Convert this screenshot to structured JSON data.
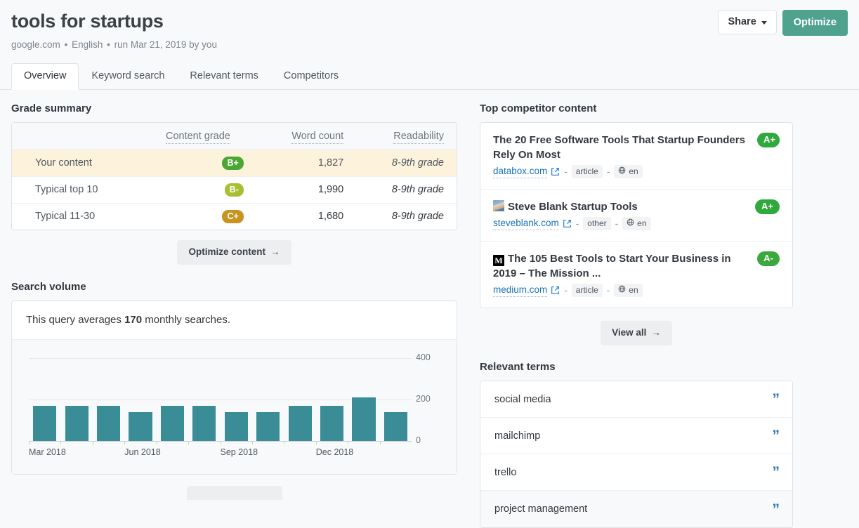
{
  "header": {
    "title": "tools for startups",
    "meta": {
      "domain": "google.com",
      "language": "English",
      "run": "run Mar 21, 2019 by you"
    },
    "share_label": "Share",
    "optimize_label": "Optimize"
  },
  "tabs": [
    {
      "label": "Overview",
      "active": true
    },
    {
      "label": "Keyword search",
      "active": false
    },
    {
      "label": "Relevant terms",
      "active": false
    },
    {
      "label": "Competitors",
      "active": false
    }
  ],
  "grade_summary": {
    "title": "Grade summary",
    "columns": [
      "",
      "Content grade",
      "Word count",
      "Readability"
    ],
    "rows": [
      {
        "label": "Your content",
        "grade": "B+",
        "grade_color": "#4aa832",
        "word_count": "1,827",
        "readability": "8-9th grade",
        "highlight": true
      },
      {
        "label": "Typical top 10",
        "grade": "B-",
        "grade_color": "#a7bf32",
        "word_count": "1,990",
        "readability": "8-9th grade",
        "highlight": false
      },
      {
        "label": "Typical 11-30",
        "grade": "C+",
        "grade_color": "#c99322",
        "word_count": "1,680",
        "readability": "8-9th grade",
        "highlight": false
      }
    ],
    "optimize_content_label": "Optimize content",
    "arrow": "→"
  },
  "search_volume": {
    "title": "Search volume",
    "summary_prefix": "This query averages",
    "summary_value": "170",
    "summary_suffix": "monthly searches."
  },
  "chart_data": {
    "type": "bar",
    "title": "Search volume",
    "xlabel": "",
    "ylabel": "",
    "ylim": [
      0,
      440
    ],
    "grid": true,
    "yticks": [
      "0",
      "200",
      "400"
    ],
    "ytick_values": [
      0,
      200,
      400
    ],
    "bar_color": "#3a8c96",
    "categories": [
      "Mar 2018",
      "Apr 2018",
      "May 2018",
      "Jun 2018",
      "Jul 2018",
      "Aug 2018",
      "Sep 2018",
      "Oct 2018",
      "Nov 2018",
      "Dec 2018",
      "Jan 2019",
      "Feb 2019"
    ],
    "visible_tick_labels": [
      "Mar 2018",
      "Jun 2018",
      "Sep 2018",
      "Dec 2018"
    ],
    "visible_tick_indices": [
      0,
      3,
      6,
      9
    ],
    "values": [
      170,
      170,
      170,
      140,
      170,
      170,
      140,
      140,
      170,
      170,
      210,
      140
    ]
  },
  "top_competitor_content": {
    "title": "Top competitor content",
    "items": [
      {
        "title": "The 20 Free Software Tools That Startup Founders Rely On Most",
        "favicon": "none",
        "favicon_letter": "",
        "domain": "databox.com",
        "type": "article",
        "lang": "en",
        "grade": "A+",
        "grade_color": "#2fa83c"
      },
      {
        "title": "Steve Blank Startup Tools",
        "favicon": "photo",
        "favicon_letter": "",
        "domain": "steveblank.com",
        "type": "other",
        "lang": "en",
        "grade": "A+",
        "grade_color": "#2fa83c"
      },
      {
        "title": "The 105 Best Tools to Start Your Business in 2019 – The Mission ...",
        "favicon": "medium",
        "favicon_letter": "M",
        "domain": "medium.com",
        "type": "article",
        "lang": "en",
        "grade": "A-",
        "grade_color": "#3aa83c"
      }
    ],
    "view_all_label": "View all",
    "arrow": "→"
  },
  "relevant_terms": {
    "title": "Relevant terms",
    "items": [
      {
        "term": "social media"
      },
      {
        "term": "mailchimp"
      },
      {
        "term": "trello"
      },
      {
        "term": "project management"
      }
    ],
    "quote_glyph": "”"
  },
  "icons": {
    "external_link": "external-link-icon",
    "globe": "globe-icon",
    "quote": "quote-icon",
    "caret_down": "chevron-down-icon"
  }
}
